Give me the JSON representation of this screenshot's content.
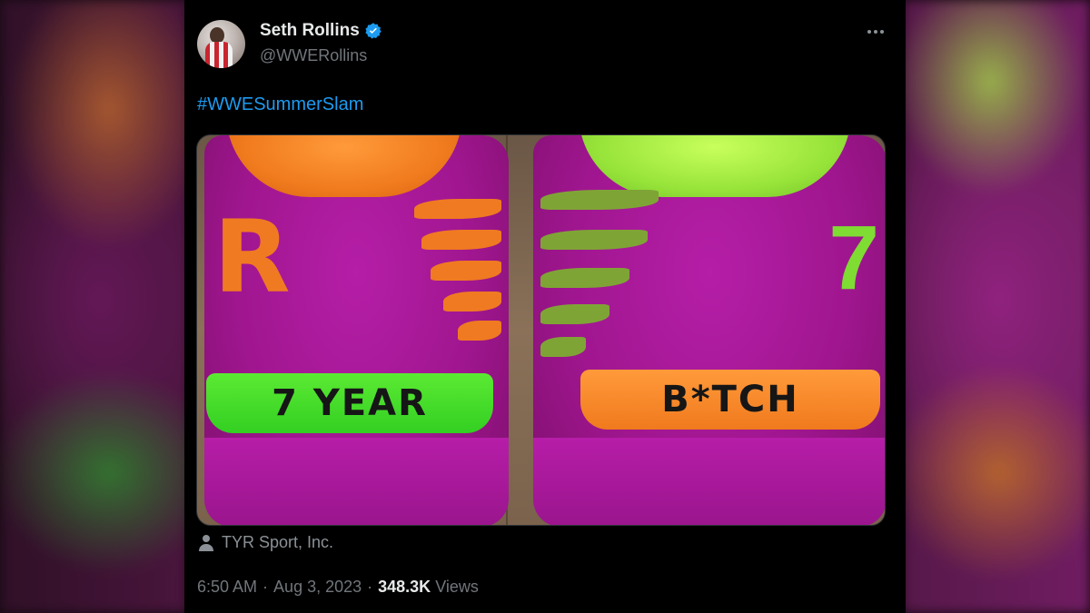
{
  "tweet": {
    "author": {
      "display_name": "Seth Rollins",
      "handle": "@WWERollins",
      "verified": true
    },
    "more_icon": "ellipsis-horizontal-icon",
    "text": "#WWESummerSlam",
    "media": {
      "left_heel_text": "7 YEAR",
      "right_heel_text": "B*TCH"
    },
    "location": "TYR Sport, Inc.",
    "time": "6:50 AM",
    "date": "Aug 3, 2023",
    "separator": "·",
    "views_count": "348.3K",
    "views_label": "Views"
  },
  "colors": {
    "link": "#1d9bf0",
    "verified_badge": "#1d9bf0",
    "text_primary": "#e7e9ea",
    "text_secondary": "#71767b",
    "background": "#000000"
  }
}
